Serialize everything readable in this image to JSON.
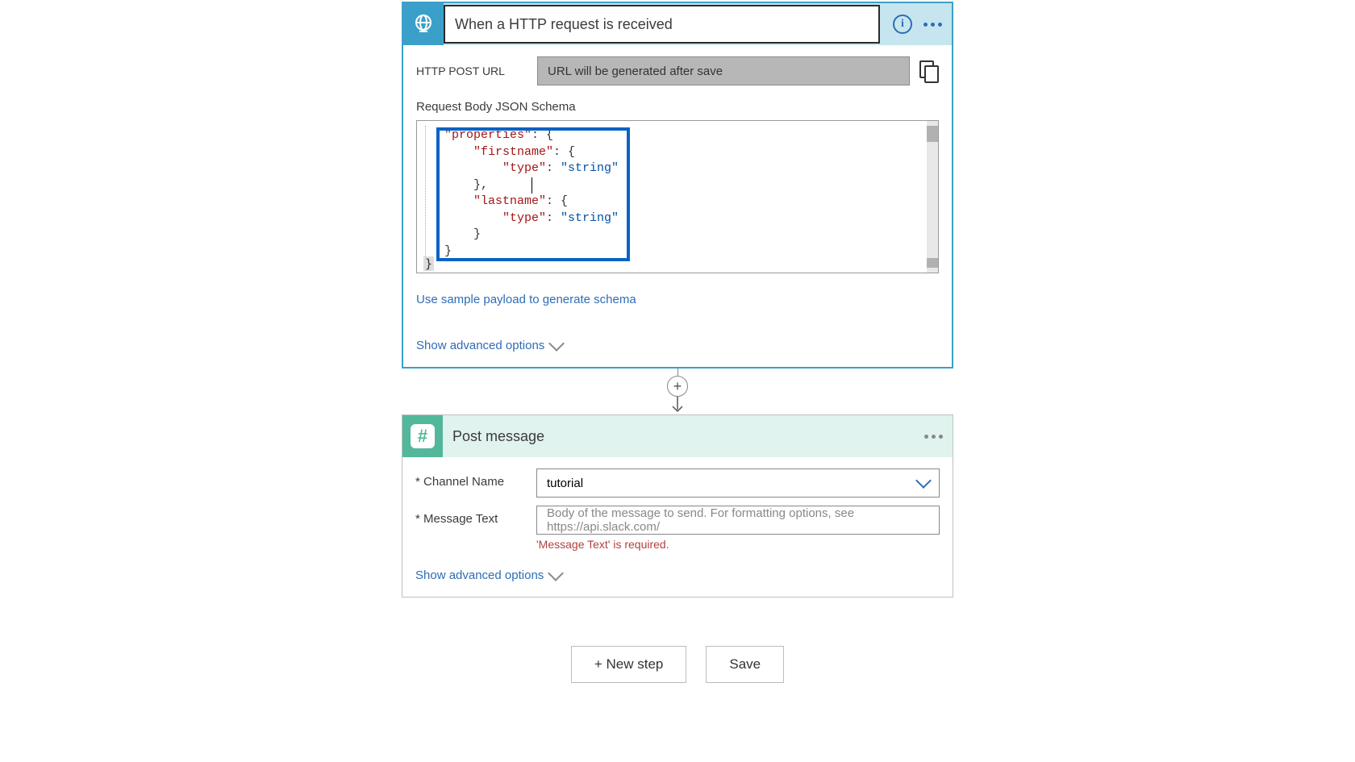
{
  "trigger": {
    "title": "When a HTTP request is received",
    "url_label": "HTTP POST URL",
    "url_value": "URL will be generated after save",
    "schema_label": "Request Body JSON Schema",
    "sample_link": "Use sample payload to generate schema",
    "advanced_link": "Show advanced options",
    "code": {
      "l1a": "\"properties\"",
      "l1b": ": {",
      "l2a": "\"firstname\"",
      "l2b": ": {",
      "l3a": "\"type\"",
      "l3b": ": ",
      "l3c": "\"string\"",
      "l4": "},",
      "l5a": "\"lastname\"",
      "l5b": ": {",
      "l6a": "\"type\"",
      "l6b": ": ",
      "l6c": "\"string\"",
      "l7": "}",
      "l8": "}",
      "end": "}"
    }
  },
  "action": {
    "title": "Post message",
    "field_channel_label": "Channel Name",
    "field_channel_value": "tutorial",
    "field_msg_label": "Message Text",
    "field_msg_placeholder": "Body of the message to send. For formatting options, see https://api.slack.com/",
    "field_msg_error": "'Message Text' is required.",
    "advanced_link": "Show advanced options"
  },
  "buttons": {
    "new_step": "+ New step",
    "save": "Save"
  }
}
